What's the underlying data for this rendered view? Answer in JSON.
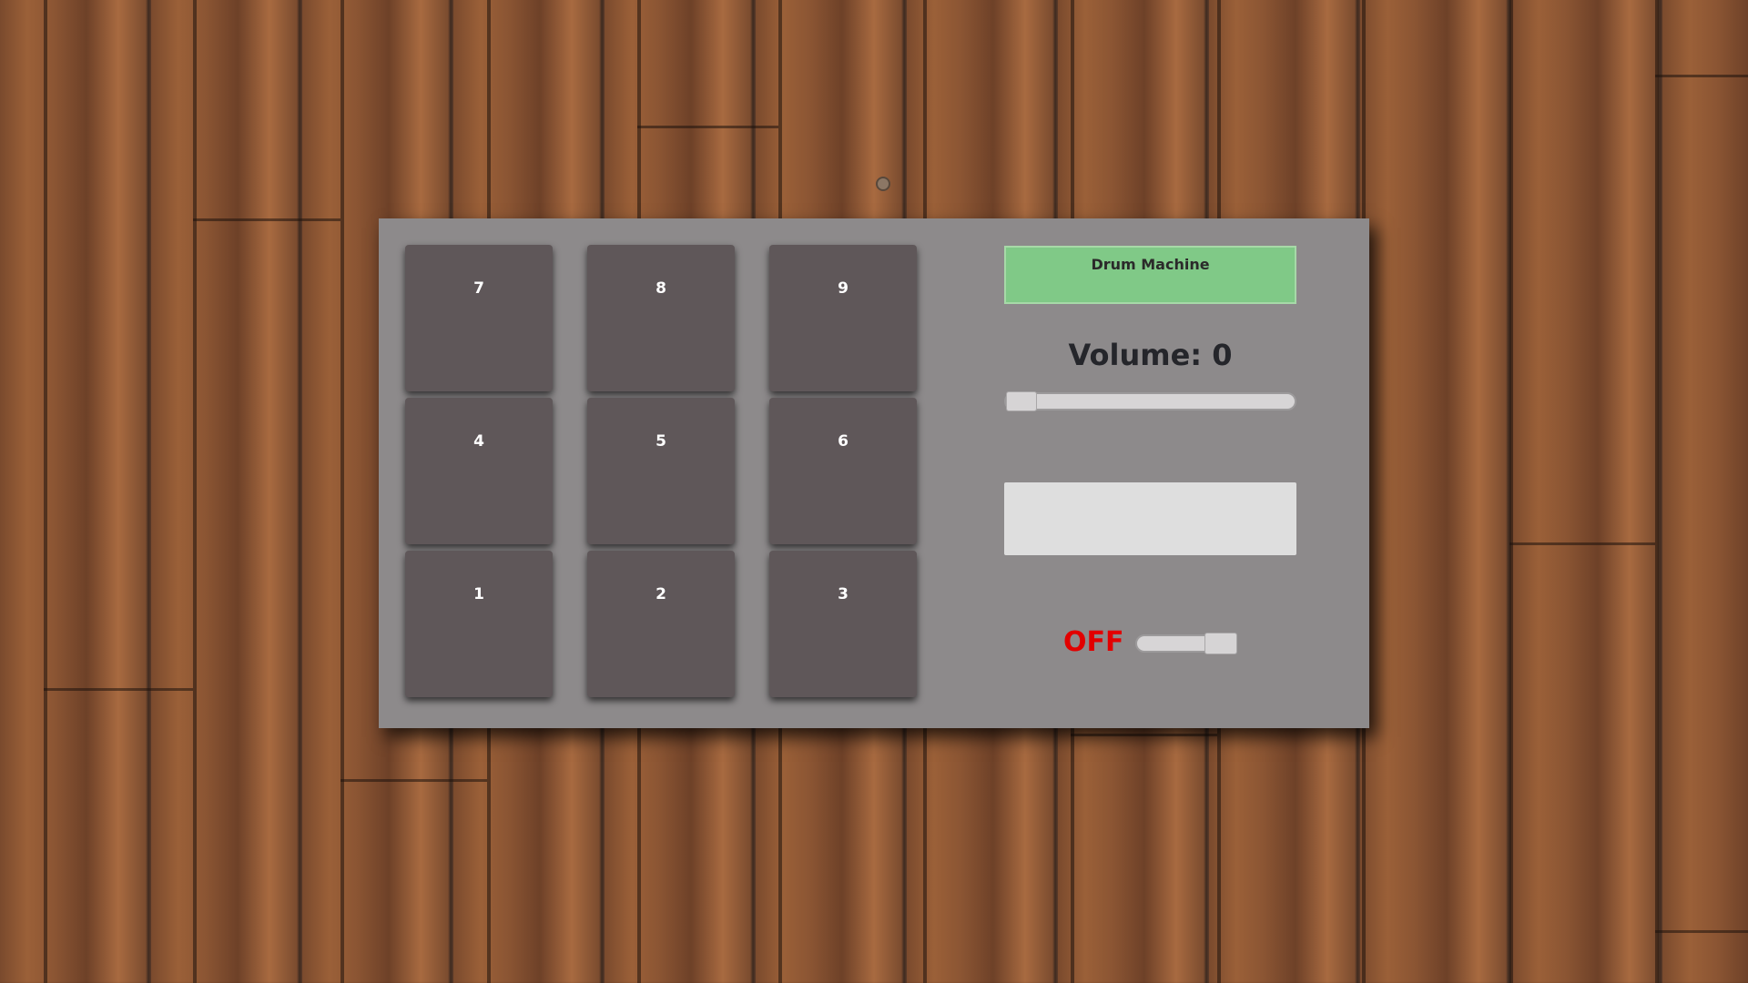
{
  "app": {
    "title": "Drum Machine"
  },
  "pads": [
    {
      "key": "7"
    },
    {
      "key": "8"
    },
    {
      "key": "9"
    },
    {
      "key": "4"
    },
    {
      "key": "5"
    },
    {
      "key": "6"
    },
    {
      "key": "1"
    },
    {
      "key": "2"
    },
    {
      "key": "3"
    }
  ],
  "controls": {
    "volume_label": "Volume: 0",
    "volume_value": 0,
    "display_text": "",
    "power_label": "OFF",
    "power_on": false
  },
  "colors": {
    "panel": "#8d8a8b",
    "pad": "#5f5759",
    "title_box": "#80c987",
    "power_off": "#e20000",
    "display": "#dedede"
  }
}
